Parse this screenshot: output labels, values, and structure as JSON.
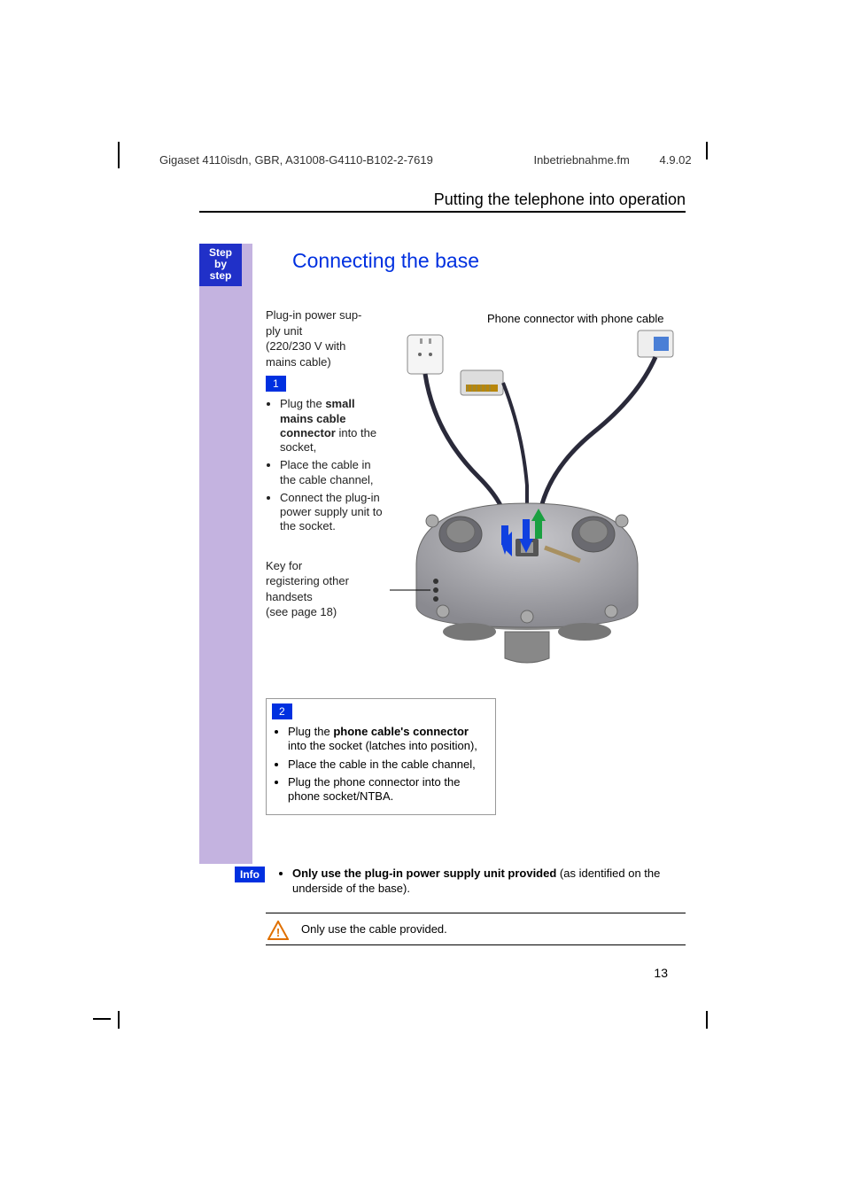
{
  "header": {
    "doc_id": "Gigaset 4110isdn, GBR, A31008-G4110-B102-2-7619",
    "file": "Inbetriebnahme.fm",
    "date": "4.9.02"
  },
  "section_title": "Putting the telephone into operation",
  "sidebar": {
    "step": "Step",
    "by": "by",
    "step2": "step"
  },
  "heading": "Connecting the base",
  "labels": {
    "psu_l1": "Plug-in power sup-",
    "psu_l2": "ply unit",
    "psu_l3": "(220/230 V with",
    "psu_l4": "mains cable)",
    "phone_connector": "Phone connector with phone cable",
    "key_l1": "Key for",
    "key_l2": "registering other",
    "key_l3": "handsets",
    "key_l4": "(see page 18)"
  },
  "step1": {
    "num": "1",
    "b1a": "Plug the ",
    "b1b": "small mains cable connector",
    "b1c": " into the socket,",
    "b2": "Place the cable in the cable channel,",
    "b3": "Connect the plug-in power supply unit to the socket."
  },
  "step2": {
    "num": "2",
    "b1a": "Plug the ",
    "b1b": "phone cable's connector",
    "b1c": " into the socket (latches into position),",
    "b2": "Place the cable in the cable channel,",
    "b3": "Plug the phone connector into the phone socket/NTBA."
  },
  "info": {
    "label": "Info",
    "text_b": "Only use the plug-in power supply unit provided",
    "text_rest": " (as identified on the underside of the base)."
  },
  "warning": "Only use the cable provided.",
  "page_number": "13"
}
